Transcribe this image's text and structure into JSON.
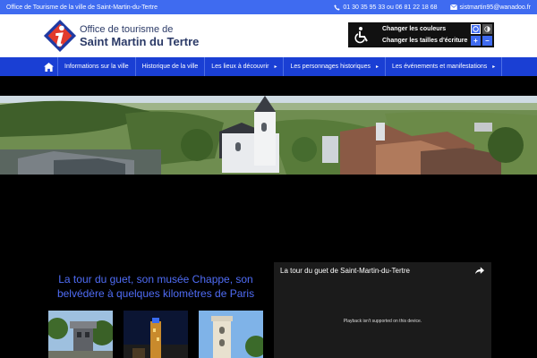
{
  "topbar": {
    "office_name": "Office de Tourisme de la ville de Saint-Martin-du-Tertre",
    "phone": "01 30 35 95 33 ou 06 81 22 18 68",
    "email": "sistmartin95@wanadoo.fr",
    "background": "#3f6bf0"
  },
  "header": {
    "logo_icon": "tourism-info-logo",
    "brand_line1": "Office de tourisme de",
    "brand_line2": "Saint Martin du Tertre"
  },
  "accessibility": {
    "change_colors": "Changer les couleurs",
    "change_text_size": "Changer les tailles d'écriture",
    "plus": "+",
    "minus": "–"
  },
  "nav": {
    "home_icon": "home-icon",
    "background": "#1a3fd4",
    "items": [
      {
        "label": "Informations sur la ville",
        "caret": ""
      },
      {
        "label": "Historique de la ville",
        "caret": ""
      },
      {
        "label": "Les lieux à découvrir",
        "caret": "▸"
      },
      {
        "label": "Les personnages historiques",
        "caret": "▸"
      },
      {
        "label": "Les événements et manifestations",
        "caret": "▸"
      }
    ]
  },
  "main": {
    "tagline": "La tour du guet, son musée Chappe, son belvédère à quelques kilomètres de Paris"
  },
  "video": {
    "title": "La tour du guet de Saint-Martin-du-Tertre",
    "message": "Playback isn't supported on this device."
  }
}
